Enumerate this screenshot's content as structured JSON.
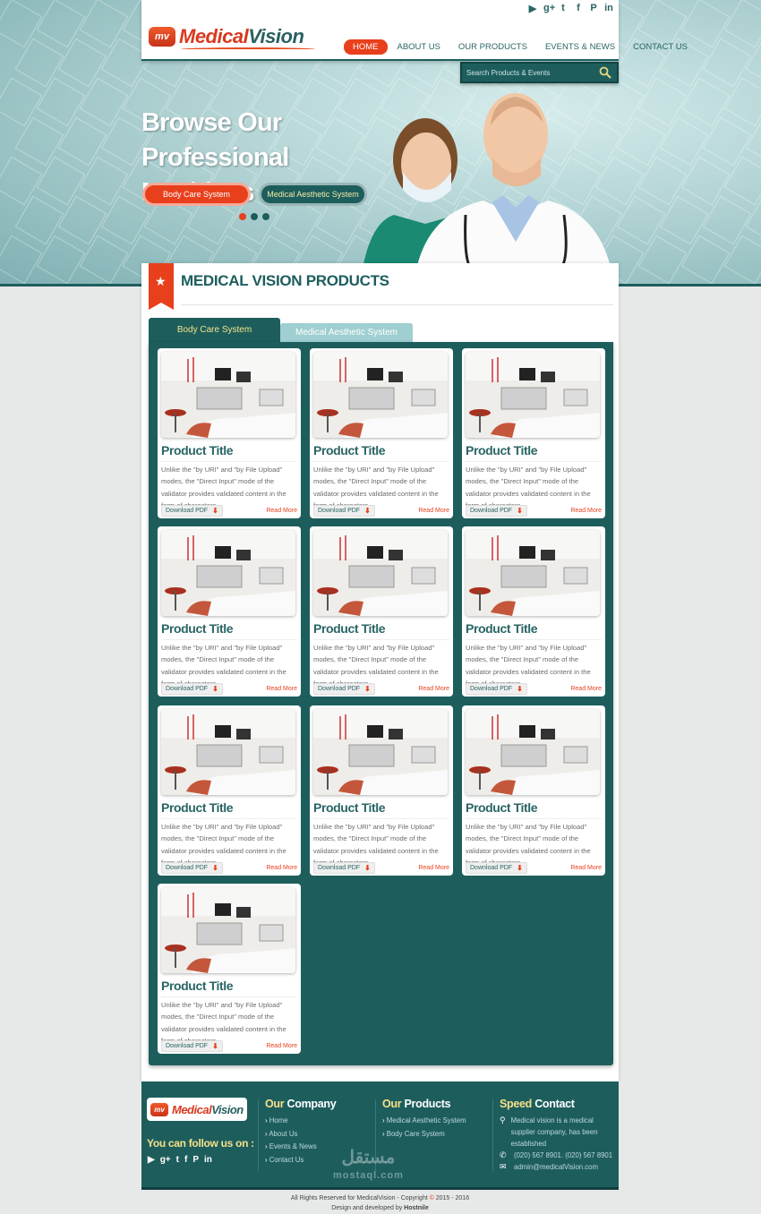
{
  "brand": {
    "logo_badge": "mv",
    "logo_part1": "Medical",
    "logo_part2": "Vision"
  },
  "social": [
    "youtube-icon",
    "google-plus-icon",
    "twitter-icon",
    "facebook-icon",
    "pinterest-icon",
    "linkedin-icon"
  ],
  "nav": {
    "items": [
      {
        "label": "HOME",
        "active": true
      },
      {
        "label": "ABOUT US",
        "active": false
      },
      {
        "label": "OUR PRODUCTS",
        "active": false
      },
      {
        "label": "EVENTS & NEWS",
        "active": false
      },
      {
        "label": "CONTACT US",
        "active": false
      }
    ]
  },
  "search": {
    "placeholder": "Search Products & Events"
  },
  "hero": {
    "title_line1": "Browse Our",
    "title_line2": "Professional Machines",
    "button1": "Body Care System",
    "button2": "Medical Aesthetic System",
    "slides": 3,
    "active_slide": 1
  },
  "section": {
    "title": "MEDICAL VISION PRODUCTS",
    "tabs": [
      {
        "label": "Body Care System",
        "active": true
      },
      {
        "label": "Medical Aesthetic System",
        "active": false
      }
    ]
  },
  "products": [
    {
      "title": "Product Title",
      "desc": "Unlike the \"by URI\" and \"by File Upload\" modes, the \"Direct Input\" mode of the validator provides validated content in the form of characters",
      "pdf": "Download PDF",
      "more": "Read More"
    },
    {
      "title": "Product Title",
      "desc": "Unlike the \"by URI\" and \"by File Upload\" modes, the \"Direct Input\" mode of the validator provides validated content in the form of characters",
      "pdf": "Download PDF",
      "more": "Read More"
    },
    {
      "title": "Product Title",
      "desc": "Unlike the \"by URI\" and \"by File Upload\" modes, the \"Direct Input\" mode of the validator provides validated content in the form of characters",
      "pdf": "Download PDF",
      "more": "Read More"
    },
    {
      "title": "Product Title",
      "desc": "Unlike the \"by URI\" and \"by File Upload\" modes, the \"Direct Input\" mode of the validator provides validated content in the form of characters",
      "pdf": "Download PDF",
      "more": "Read More"
    },
    {
      "title": "Product Title",
      "desc": "Unlike the \"by URI\" and \"by File Upload\" modes, the \"Direct Input\" mode of the validator provides validated content in the form of characters",
      "pdf": "Download PDF",
      "more": "Read More"
    },
    {
      "title": "Product Title",
      "desc": "Unlike the \"by URI\" and \"by File Upload\" modes, the \"Direct Input\" mode of the validator provides validated content in the form of characters",
      "pdf": "Download PDF",
      "more": "Read More"
    },
    {
      "title": "Product Title",
      "desc": "Unlike the \"by URI\" and \"by File Upload\" modes, the \"Direct Input\" mode of the validator provides validated content in the form of characters",
      "pdf": "Download PDF",
      "more": "Read More"
    },
    {
      "title": "Product Title",
      "desc": "Unlike the \"by URI\" and \"by File Upload\" modes, the \"Direct Input\" mode of the validator provides validated content in the form of characters",
      "pdf": "Download PDF",
      "more": "Read More"
    },
    {
      "title": "Product Title",
      "desc": "Unlike the \"by URI\" and \"by File Upload\" modes, the \"Direct Input\" mode of the validator provides validated content in the form of characters",
      "pdf": "Download PDF",
      "more": "Read More"
    },
    {
      "title": "Product Title",
      "desc": "Unlike the \"by URI\" and \"by File Upload\" modes, the \"Direct Input\" mode of the validator provides validated content in the form of characters",
      "pdf": "Download PDF",
      "more": "Read More"
    }
  ],
  "footer": {
    "follow": "You can follow us on :",
    "company": {
      "hl": "Our",
      "rest": " Company",
      "links": [
        "Home",
        "About Us",
        "Events & News",
        "Contact Us"
      ]
    },
    "products": {
      "hl": "Our",
      "rest": " Products",
      "links": [
        "Medical Aesthetic System",
        "Body Care System"
      ]
    },
    "contact": {
      "hl": "Speed",
      "rest": " Contact",
      "address": "Medical vision is a medical supplier company, has been established",
      "phone": "(020) 567 8901. (020) 567 8901",
      "email": "admin@medicalVision.com"
    }
  },
  "watermark": {
    "arabic": "مستقل",
    "latin": "mostaql.com"
  },
  "copyright": {
    "line1a": "All Rights Reserved for MedicalVision - Copyright ",
    "symbol": "©",
    "line1b": " 2015 - 2016",
    "line2a": "Design and developed by ",
    "line2b": "Hostnile"
  },
  "colors": {
    "teal": "#1d5e5d",
    "orange": "#e8401c",
    "yellow": "#f6e089"
  }
}
